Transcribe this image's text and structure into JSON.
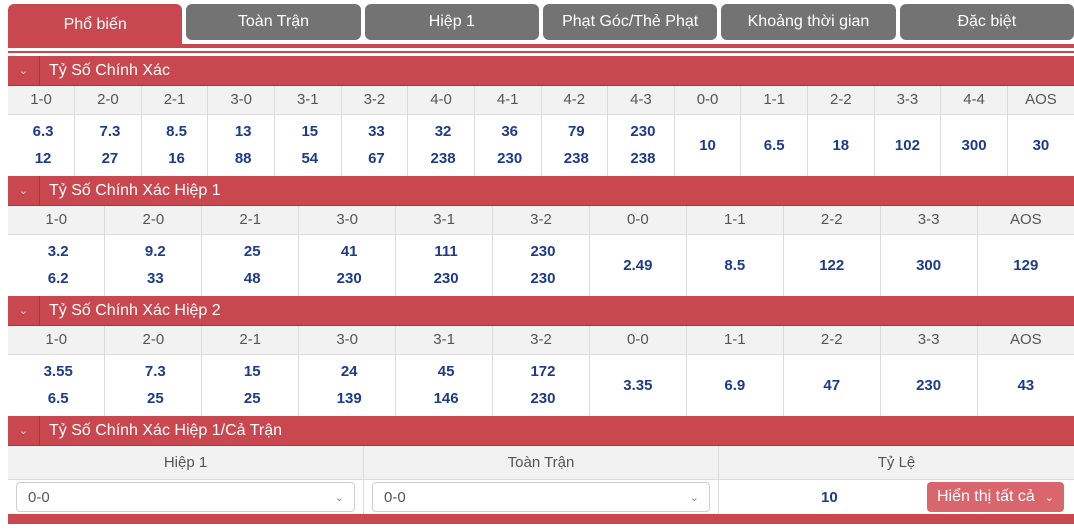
{
  "tabs": [
    {
      "label": "Phổ biến",
      "active": true
    },
    {
      "label": "Toàn Trận",
      "active": false
    },
    {
      "label": "Hiệp 1",
      "active": false
    },
    {
      "label": "Phạt Góc/Thẻ Phạt",
      "active": false
    },
    {
      "label": "Khoảng thời gian",
      "active": false
    },
    {
      "label": "Đặc biệt",
      "active": false
    }
  ],
  "colors": {
    "accent": "#c9474f",
    "tab_inactive": "#737373",
    "odds_text": "#1d3b8a",
    "button": "#d9666c"
  },
  "sections": [
    {
      "title": "Tỷ Số Chính Xác",
      "icon": "chevron-down-icon",
      "headers": [
        "1-0",
        "2-0",
        "2-1",
        "3-0",
        "3-1",
        "3-2",
        "4-0",
        "4-1",
        "4-2",
        "4-3",
        "0-0",
        "1-1",
        "2-2",
        "3-3",
        "4-4",
        "AOS"
      ],
      "cells": [
        [
          "6.3",
          "12"
        ],
        [
          "7.3",
          "27"
        ],
        [
          "8.5",
          "16"
        ],
        [
          "13",
          "88"
        ],
        [
          "15",
          "54"
        ],
        [
          "33",
          "67"
        ],
        [
          "32",
          "238"
        ],
        [
          "36",
          "230"
        ],
        [
          "79",
          "238"
        ],
        [
          "230",
          "238"
        ],
        [
          "10"
        ],
        [
          "6.5"
        ],
        [
          "18"
        ],
        [
          "102"
        ],
        [
          "300"
        ],
        [
          "30"
        ]
      ]
    },
    {
      "title": "Tỷ Số Chính Xác Hiệp 1",
      "icon": "chevron-down-icon",
      "headers": [
        "1-0",
        "2-0",
        "2-1",
        "3-0",
        "3-1",
        "3-2",
        "0-0",
        "1-1",
        "2-2",
        "3-3",
        "AOS"
      ],
      "cells": [
        [
          "3.2",
          "6.2"
        ],
        [
          "9.2",
          "33"
        ],
        [
          "25",
          "48"
        ],
        [
          "41",
          "230"
        ],
        [
          "111",
          "230"
        ],
        [
          "230",
          "230"
        ],
        [
          "2.49"
        ],
        [
          "8.5"
        ],
        [
          "122"
        ],
        [
          "300"
        ],
        [
          "129"
        ]
      ]
    },
    {
      "title": "Tỷ Số Chính Xác Hiệp 2",
      "icon": "chevron-down-icon",
      "headers": [
        "1-0",
        "2-0",
        "2-1",
        "3-0",
        "3-1",
        "3-2",
        "0-0",
        "1-1",
        "2-2",
        "3-3",
        "AOS"
      ],
      "cells": [
        [
          "3.55",
          "6.5"
        ],
        [
          "7.3",
          "25"
        ],
        [
          "15",
          "25"
        ],
        [
          "24",
          "139"
        ],
        [
          "45",
          "146"
        ],
        [
          "172",
          "230"
        ],
        [
          "3.35"
        ],
        [
          "6.9"
        ],
        [
          "47"
        ],
        [
          "230"
        ],
        [
          "43"
        ]
      ]
    }
  ],
  "htft": {
    "title": "Tỷ Số Chính Xác Hiệp 1/Cả Trận",
    "icon": "chevron-down-icon",
    "headers": {
      "ht": "Hiệp 1",
      "ft": "Toàn Trận",
      "odds": "Tỷ Lệ"
    },
    "ht_selected": "0-0",
    "ft_selected": "0-0",
    "odds": "10",
    "show_all_label": "Hiển thị tất cả"
  }
}
